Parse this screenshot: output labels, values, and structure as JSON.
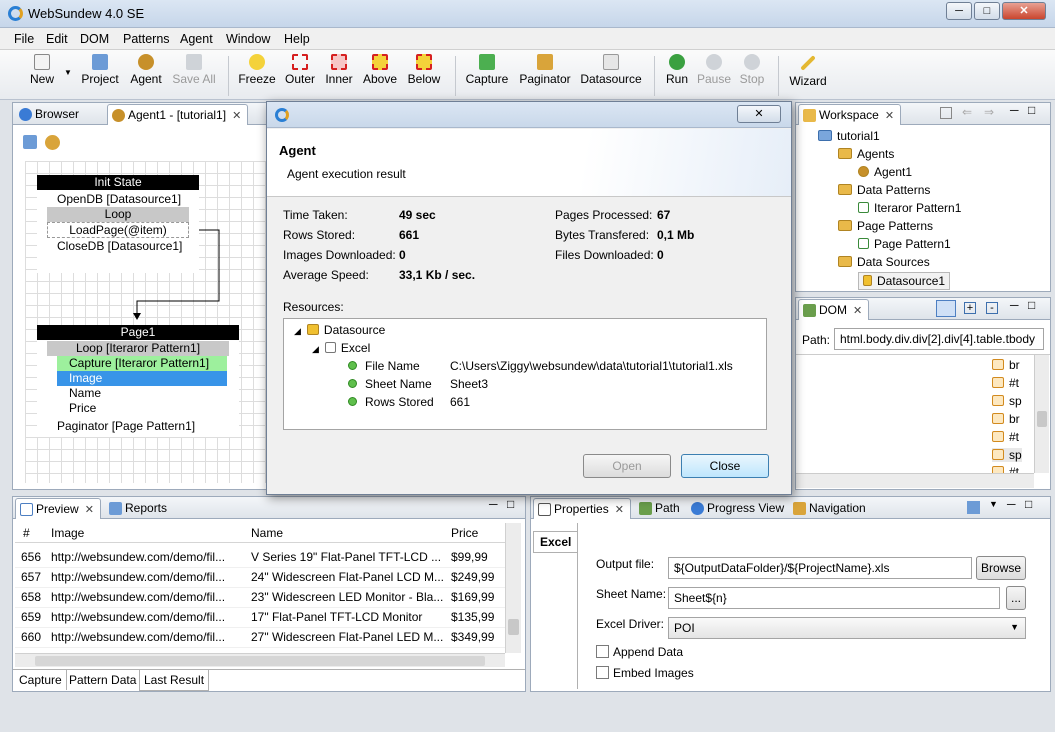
{
  "window": {
    "title": "WebSundew 4.0 SE"
  },
  "menu": [
    "File",
    "Edit",
    "DOM",
    "Patterns",
    "Agent",
    "Window",
    "Help"
  ],
  "toolbar": {
    "new": "New",
    "project": "Project",
    "agent": "Agent",
    "save_all": "Save All",
    "freeze": "Freeze",
    "outer": "Outer",
    "inner": "Inner",
    "above": "Above",
    "below": "Below",
    "capture": "Capture",
    "paginator": "Paginator",
    "datasource": "Datasource",
    "run": "Run",
    "pause": "Pause",
    "stop": "Stop",
    "wizard": "Wizard"
  },
  "editor": {
    "tab_browser": "Browser",
    "tab_agent": "Agent1 - [tutorial1]"
  },
  "diagram": {
    "init_state": "Init State",
    "open_db": "OpenDB [Datasource1]",
    "loop": "Loop",
    "load_page": "LoadPage(@item)",
    "close_db": "CloseDB [Datasource1]",
    "page1": "Page1",
    "loop_iter": "Loop [Iteraror Pattern1]",
    "capture_iter": "Capture [Iteraror Pattern1]",
    "image": "Image",
    "name": "Name",
    "price": "Price",
    "paginator": "Paginator [Page Pattern1]"
  },
  "workspace": {
    "tab": "Workspace",
    "items": [
      "tutorial1",
      "Agents",
      "Agent1",
      "Data Patterns",
      "Iteraror Pattern1",
      "Page Patterns",
      "Page Pattern1",
      "Data Sources",
      "Datasource1"
    ]
  },
  "dom": {
    "tab": "DOM",
    "path_label": "Path:",
    "path_value": "html.body.div.div[2].div[4].table.tbody",
    "nodes": [
      "br",
      "#t",
      "sp",
      "br",
      "#t",
      "sp",
      "#t"
    ]
  },
  "dialog": {
    "header": "Agent",
    "subheader": "Agent execution result",
    "stats_left": [
      {
        "label": "Time Taken:",
        "value": "49 sec"
      },
      {
        "label": "Rows Stored:",
        "value": "661"
      },
      {
        "label": "Images Downloaded:",
        "value": "0"
      },
      {
        "label": "Average Speed:",
        "value": "33,1 Kb / sec."
      }
    ],
    "stats_right": [
      {
        "label": "Pages Processed:",
        "value": "67"
      },
      {
        "label": "Bytes Transfered:",
        "value": "0,1 Mb"
      },
      {
        "label": "Files Downloaded:",
        "value": "0"
      }
    ],
    "resources_label": "Resources:",
    "res_datasource": "Datasource",
    "res_excel": "Excel",
    "res_props": [
      {
        "k": "File Name",
        "v": "C:\\Users\\Ziggy\\websundew\\data\\tutorial1\\tutorial1.xls"
      },
      {
        "k": "Sheet Name",
        "v": "Sheet3"
      },
      {
        "k": "Rows Stored",
        "v": "661"
      }
    ],
    "open": "Open",
    "close": "Close"
  },
  "preview": {
    "tab_preview": "Preview",
    "tab_reports": "Reports",
    "headers": [
      "#",
      "Image",
      "Name",
      "Price"
    ],
    "rows": [
      [
        "656",
        "http://websundew.com/demo/fil...",
        "V Series 19\" Flat-Panel TFT-LCD ...",
        "$99,99"
      ],
      [
        "657",
        "http://websundew.com/demo/fil...",
        "24\" Widescreen Flat-Panel LCD M...",
        "$249,99"
      ],
      [
        "658",
        "http://websundew.com/demo/fil...",
        "23\" Widescreen LED Monitor - Bla...",
        "$169,99"
      ],
      [
        "659",
        "http://websundew.com/demo/fil...",
        "17\" Flat-Panel TFT-LCD Monitor",
        "$135,99"
      ],
      [
        "660",
        "http://websundew.com/demo/fil...",
        "27\" Widescreen Flat-Panel LED M...",
        "$349,99"
      ]
    ],
    "bottom_tabs": [
      "Capture",
      "Pattern Data",
      "Last Result"
    ]
  },
  "properties": {
    "tabs": [
      "Properties",
      "Path",
      "Progress View",
      "Navigation"
    ],
    "side_tab": "Excel",
    "output_label": "Output file:",
    "output_value": "${OutputDataFolder}/${ProjectName}.xls",
    "browse": "Browse",
    "sheet_label": "Sheet Name:",
    "sheet_value": "Sheet${n}",
    "more": "...",
    "driver_label": "Excel Driver:",
    "driver_value": "POI",
    "append": "Append Data",
    "embed": "Embed Images"
  }
}
